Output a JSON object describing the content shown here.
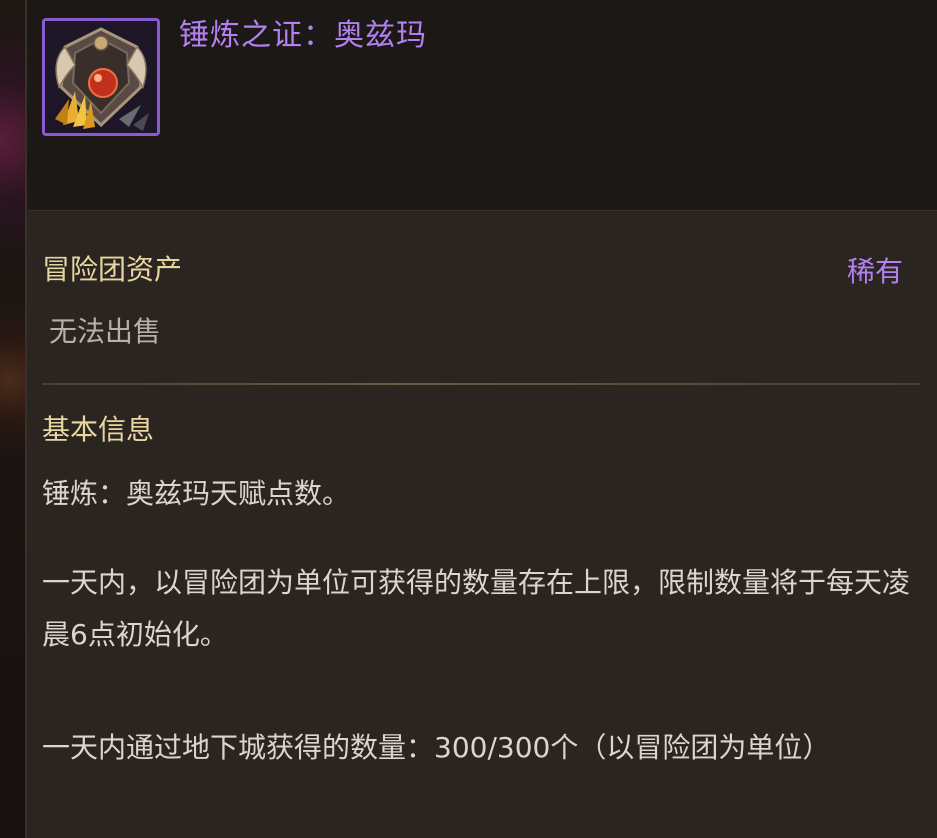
{
  "item": {
    "name": "锤炼之证：奥兹玛",
    "icon": "ozma-emblem-icon",
    "frame_color": "#8a5bd0",
    "name_color": "#b280f0"
  },
  "meta": {
    "category": "冒险团资产",
    "rarity": "稀有",
    "trade": "无法出售"
  },
  "info": {
    "heading": "基本信息",
    "line1": "锤炼：奥兹玛天赋点数。",
    "paragraph1": "一天内，以冒险团为单位可获得的数量存在上限，限制数量将于每天凌晨6点初始化。",
    "paragraph2": "一天内通过地下城获得的数量：300/300个（以冒险团为单位）"
  }
}
